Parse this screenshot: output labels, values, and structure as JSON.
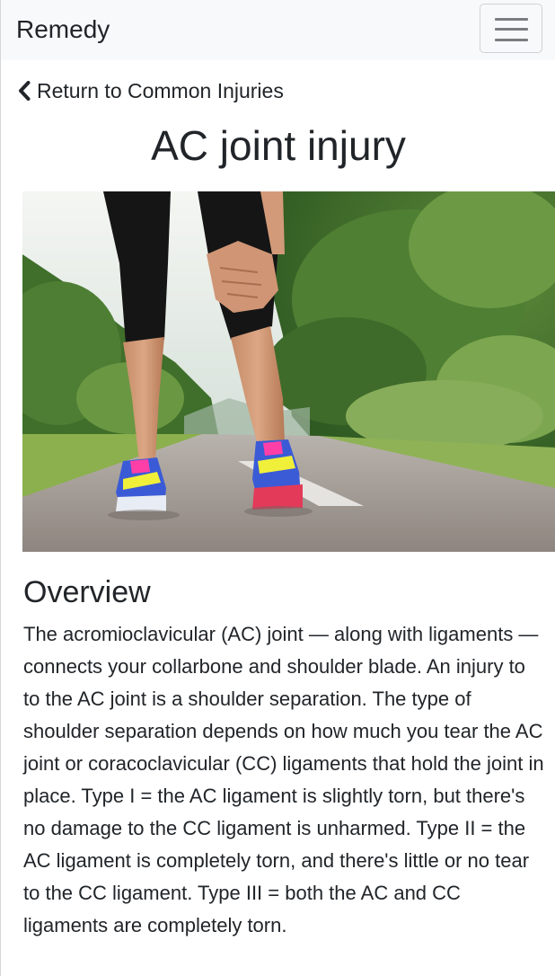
{
  "navbar": {
    "brand": "Remedy",
    "toggler_icon": "hamburger-menu-icon"
  },
  "back_link": {
    "icon": "chevron-left-icon",
    "label": "Return to Common Injuries"
  },
  "page": {
    "title": "AC joint injury"
  },
  "hero": {
    "alt": "Runner on a road holding her knee"
  },
  "overview": {
    "heading": "Overview",
    "body": "The acromioclavicular (AC) joint — along with ligaments — connects your collarbone and shoulder blade. An injury to to the AC joint is a shoulder separation. The type of shoulder separation depends on how much you tear the AC joint or coracoclavicular (CC) ligaments that hold the joint in place. Type I = the AC ligament is slightly torn, but there's no damage to the CC ligament is unharmed. Type II = the AC ligament is completely torn, and there's little or no tear to the CC ligament. Type III = both the AC and CC ligaments are completely torn."
  },
  "colors": {
    "navbar_bg": "#f8f9fa",
    "text": "#212529"
  }
}
